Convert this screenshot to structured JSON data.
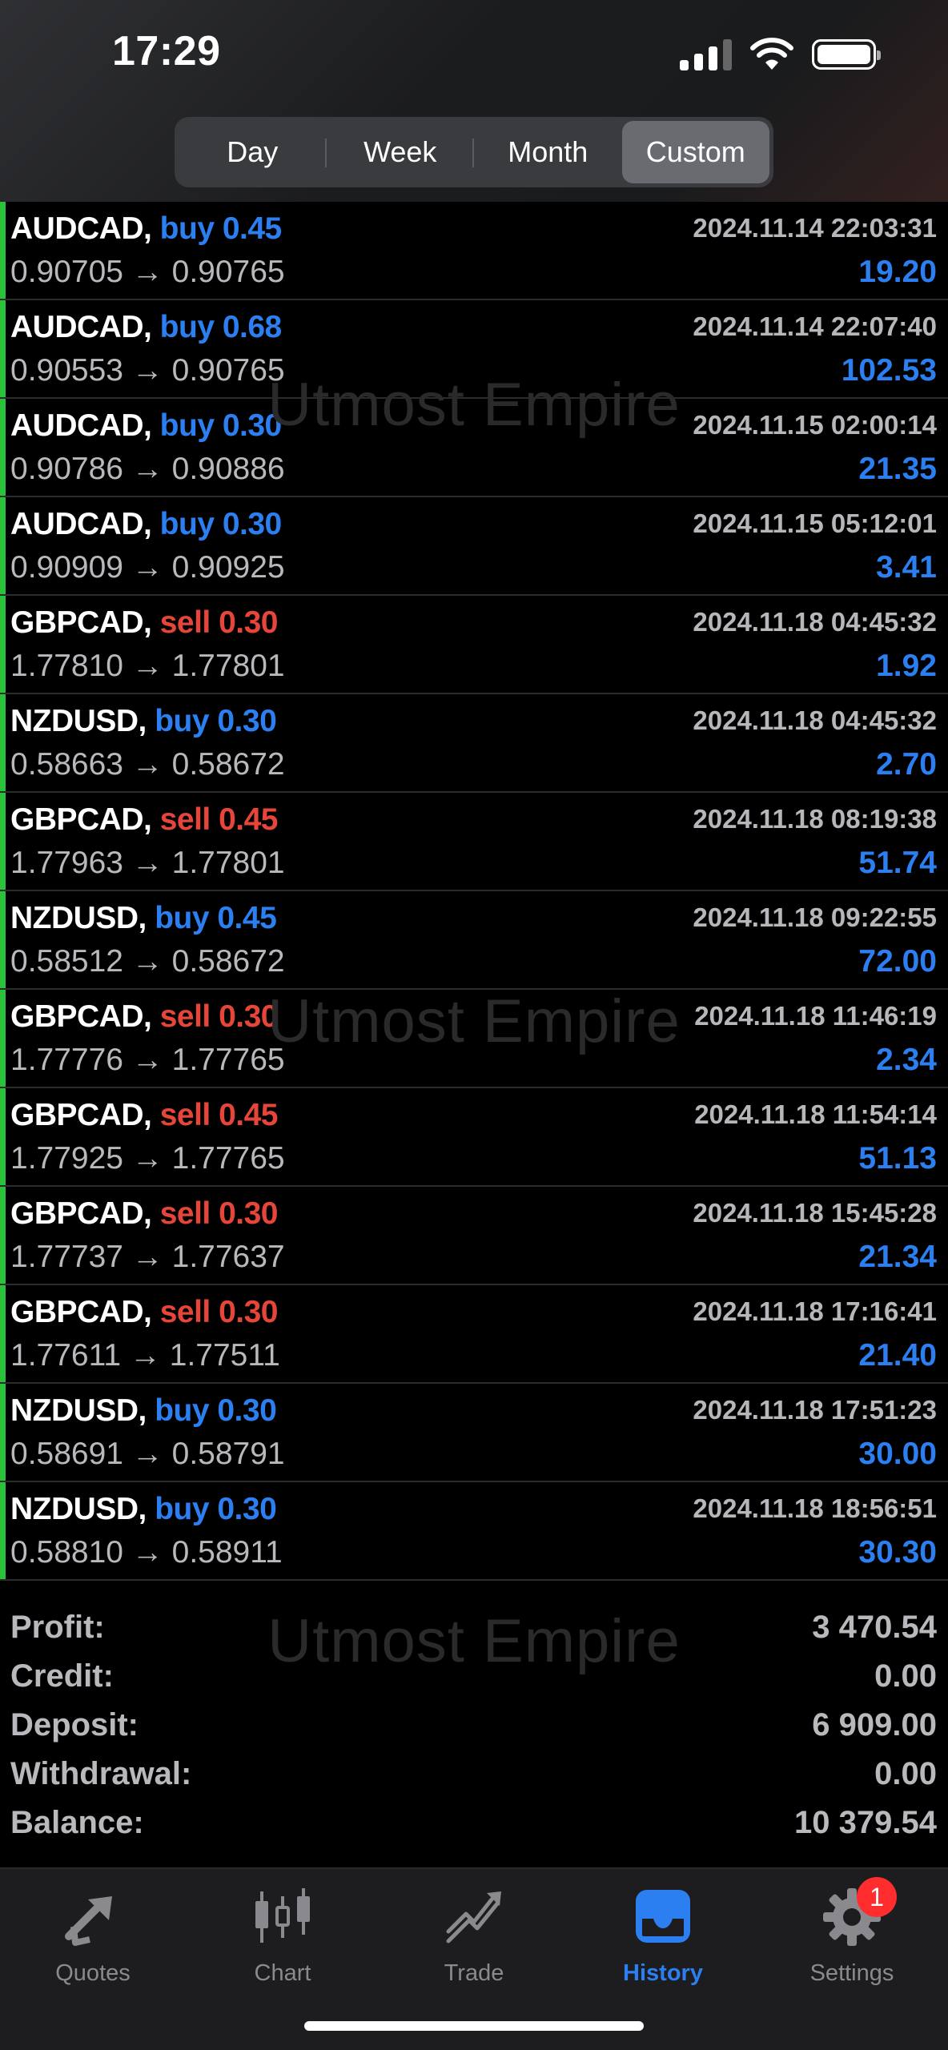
{
  "status_bar": {
    "time": "17:29"
  },
  "period_tabs": [
    {
      "label": "Day",
      "active": false
    },
    {
      "label": "Week",
      "active": false
    },
    {
      "label": "Month",
      "active": false
    },
    {
      "label": "Custom",
      "active": true
    }
  ],
  "watermark": "Utmost Empire",
  "trades": [
    {
      "symbol": "AUDCAD,",
      "side": "buy",
      "volume": "0.45",
      "side_text": "buy 0.45",
      "prices": "0.90705 → 0.90765",
      "time": "2024.11.14 22:03:31",
      "profit": "19.20"
    },
    {
      "symbol": "AUDCAD,",
      "side": "buy",
      "volume": "0.68",
      "side_text": "buy 0.68",
      "prices": "0.90553 → 0.90765",
      "time": "2024.11.14 22:07:40",
      "profit": "102.53"
    },
    {
      "symbol": "AUDCAD,",
      "side": "buy",
      "volume": "0.30",
      "side_text": "buy 0.30",
      "prices": "0.90786 → 0.90886",
      "time": "2024.11.15 02:00:14",
      "profit": "21.35"
    },
    {
      "symbol": "AUDCAD,",
      "side": "buy",
      "volume": "0.30",
      "side_text": "buy 0.30",
      "prices": "0.90909 → 0.90925",
      "time": "2024.11.15 05:12:01",
      "profit": "3.41"
    },
    {
      "symbol": "GBPCAD,",
      "side": "sell",
      "volume": "0.30",
      "side_text": "sell 0.30",
      "prices": "1.77810 → 1.77801",
      "time": "2024.11.18 04:45:32",
      "profit": "1.92"
    },
    {
      "symbol": "NZDUSD,",
      "side": "buy",
      "volume": "0.30",
      "side_text": "buy 0.30",
      "prices": "0.58663 → 0.58672",
      "time": "2024.11.18 04:45:32",
      "profit": "2.70"
    },
    {
      "symbol": "GBPCAD,",
      "side": "sell",
      "volume": "0.45",
      "side_text": "sell 0.45",
      "prices": "1.77963 → 1.77801",
      "time": "2024.11.18 08:19:38",
      "profit": "51.74"
    },
    {
      "symbol": "NZDUSD,",
      "side": "buy",
      "volume": "0.45",
      "side_text": "buy 0.45",
      "prices": "0.58512 → 0.58672",
      "time": "2024.11.18 09:22:55",
      "profit": "72.00"
    },
    {
      "symbol": "GBPCAD,",
      "side": "sell",
      "volume": "0.30",
      "side_text": "sell 0.30",
      "prices": "1.77776 → 1.77765",
      "time": "2024.11.18 11:46:19",
      "profit": "2.34"
    },
    {
      "symbol": "GBPCAD,",
      "side": "sell",
      "volume": "0.45",
      "side_text": "sell 0.45",
      "prices": "1.77925 → 1.77765",
      "time": "2024.11.18 11:54:14",
      "profit": "51.13"
    },
    {
      "symbol": "GBPCAD,",
      "side": "sell",
      "volume": "0.30",
      "side_text": "sell 0.30",
      "prices": "1.77737 → 1.77637",
      "time": "2024.11.18 15:45:28",
      "profit": "21.34"
    },
    {
      "symbol": "GBPCAD,",
      "side": "sell",
      "volume": "0.30",
      "side_text": "sell 0.30",
      "prices": "1.77611 → 1.77511",
      "time": "2024.11.18 17:16:41",
      "profit": "21.40"
    },
    {
      "symbol": "NZDUSD,",
      "side": "buy",
      "volume": "0.30",
      "side_text": "buy 0.30",
      "prices": "0.58691 → 0.58791",
      "time": "2024.11.18 17:51:23",
      "profit": "30.00"
    },
    {
      "symbol": "NZDUSD,",
      "side": "buy",
      "volume": "0.30",
      "side_text": "buy 0.30",
      "prices": "0.58810 → 0.58911",
      "time": "2024.11.18 18:56:51",
      "profit": "30.30"
    }
  ],
  "summary": [
    {
      "label": "Profit:",
      "value": "3 470.54"
    },
    {
      "label": "Credit:",
      "value": "0.00"
    },
    {
      "label": "Deposit:",
      "value": "6 909.00"
    },
    {
      "label": "Withdrawal:",
      "value": "0.00"
    },
    {
      "label": "Balance:",
      "value": "10 379.54"
    }
  ],
  "tab_bar": [
    {
      "label": "Quotes",
      "icon": "quotes-icon",
      "active": false
    },
    {
      "label": "Chart",
      "icon": "candlestick-chart-icon",
      "active": false
    },
    {
      "label": "Trade",
      "icon": "trade-icon",
      "active": false
    },
    {
      "label": "History",
      "icon": "inbox-history-icon",
      "active": true
    },
    {
      "label": "Settings",
      "icon": "gear-icon",
      "active": false,
      "badge": "1"
    }
  ],
  "colors": {
    "buy": "#2b7ff0",
    "sell": "#e6453a",
    "profit": "#2b7ff0",
    "row_marker": "#29c23a",
    "active_tab": "#2b7ff0",
    "badge": "#ff2d2d"
  }
}
